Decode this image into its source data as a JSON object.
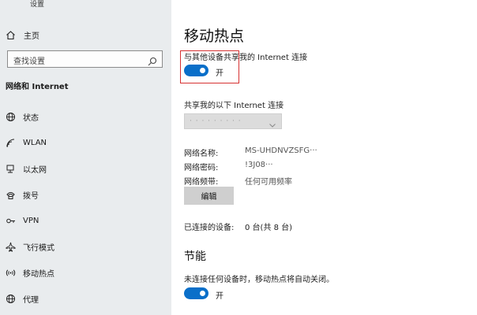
{
  "window": {
    "title": "设置"
  },
  "sidebar": {
    "home_label": "主页",
    "search_placeholder": "查找设置",
    "section_title": "网络和 Internet",
    "items": [
      {
        "label": "状态",
        "icon": "globe-icon"
      },
      {
        "label": "WLAN",
        "icon": "wifi-icon"
      },
      {
        "label": "以太网",
        "icon": "ethernet-icon"
      },
      {
        "label": "拨号",
        "icon": "dialup-icon"
      },
      {
        "label": "VPN",
        "icon": "vpn-icon"
      },
      {
        "label": "飞行模式",
        "icon": "airplane-icon"
      },
      {
        "label": "移动热点",
        "icon": "hotspot-icon"
      },
      {
        "label": "代理",
        "icon": "proxy-globe-icon"
      }
    ]
  },
  "main": {
    "title": "移动热点",
    "share_label": "与其他设备共享我的 Internet 连接",
    "share_toggle": {
      "state": "on",
      "text": "开"
    },
    "share_from_label": "共享我的以下 Internet 连接",
    "share_from_value": "· · · · · · · · ·",
    "network_name_label": "网络名称:",
    "network_name_value": "MS-UHDNVZSFG···",
    "network_password_label": "网络密码:",
    "network_password_value": "!3J08···",
    "network_band_label": "网络频带:",
    "network_band_value": "任何可用频率",
    "edit_button": "编辑",
    "connected_label": "已连接的设备:",
    "connected_value": "0 台(共 8 台)",
    "power_section_title": "节能",
    "power_desc": "未连接任何设备时，移动热点将自动关闭。",
    "power_toggle": {
      "state": "on",
      "text": "开"
    }
  },
  "colors": {
    "accent": "#0a6fc9",
    "sidebar_bg": "#e9ecee",
    "highlight_box": "#d63232"
  }
}
